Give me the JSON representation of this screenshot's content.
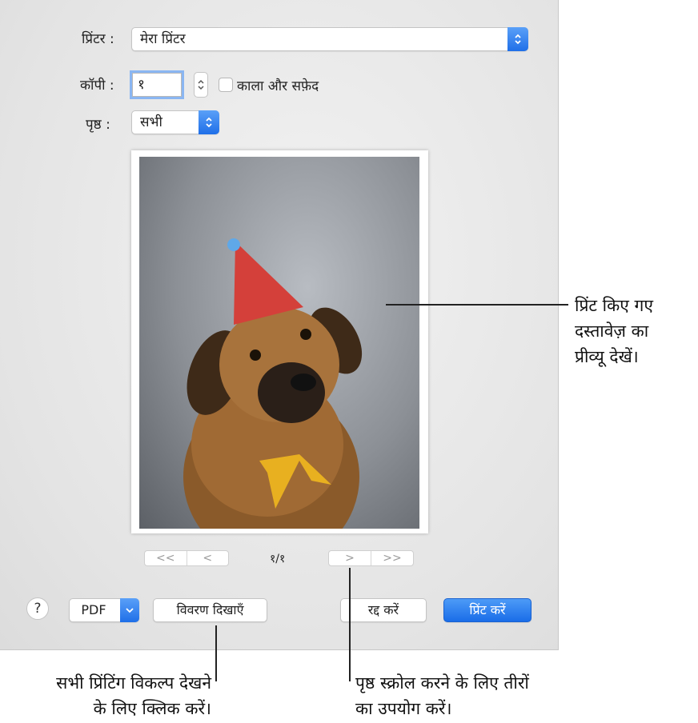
{
  "printer": {
    "label": "प्रिंटर :",
    "value": "मेरा प्रिंटर"
  },
  "copies": {
    "label": "कॉपी :",
    "value": "१",
    "bw_label": "काला और सफ़ेद",
    "bw_checked": false
  },
  "pages": {
    "label": "पृष्ठ :",
    "value": "सभी"
  },
  "preview": {
    "page_indicator": "१/१",
    "first_glyph": "<<",
    "prev_glyph": "<",
    "next_glyph": ">",
    "last_glyph": ">>"
  },
  "footer": {
    "help_label": "?",
    "pdf_label": "PDF",
    "show_details_label": "विवरण दिखाएँ",
    "cancel_label": "रद्द करें",
    "print_label": "प्रिंट करें"
  },
  "callouts": {
    "preview_line1": "प्रिंट किए गए",
    "preview_line2": "दस्तावेज़ का",
    "preview_line3": "प्रीव्यू देखें।",
    "details_line1": "सभी प्रिंटिंग विकल्प देखने",
    "details_line2": "के लिए क्लिक करें।",
    "arrows_line1": "पृष्ठ स्क्रोल करने के लिए तीरों",
    "arrows_line2": "का उपयोग करें।"
  },
  "colors": {
    "accent": "#1f6fe8",
    "dialog_bg": "#e6e6e6"
  }
}
